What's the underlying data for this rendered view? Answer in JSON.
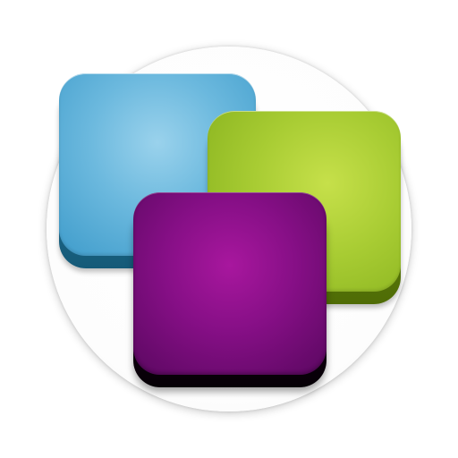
{
  "icon": {
    "name": "stacked-tiles-icon",
    "colors": {
      "backdrop": "#ffffff",
      "tile_blue": "#6cb9de",
      "tile_green": "#a8cc33",
      "tile_purple": "#860f86"
    }
  }
}
